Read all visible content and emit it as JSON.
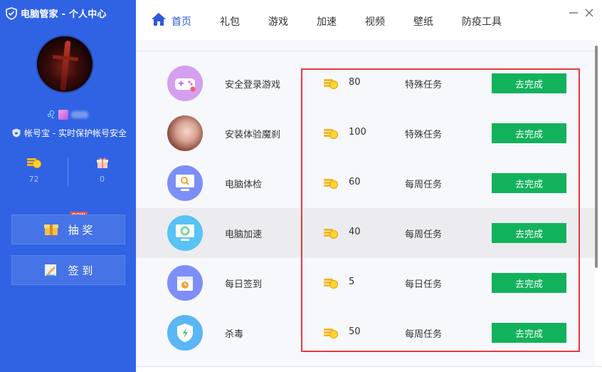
{
  "app": {
    "title": "电脑管家 - 个人中心"
  },
  "sidebar": {
    "guard_text": "帐号宝 - 实时保护帐号安全",
    "coins": "72",
    "gifts": "0",
    "new_badge": "new",
    "lottery_label": "抽 奖",
    "checkin_label": "签 到"
  },
  "nav": {
    "tabs": [
      {
        "label": "首页",
        "active": true
      },
      {
        "label": "礼包"
      },
      {
        "label": "游戏"
      },
      {
        "label": "加速"
      },
      {
        "label": "视频"
      },
      {
        "label": "壁纸"
      },
      {
        "label": "防疫工具"
      }
    ]
  },
  "tasks": [
    {
      "name": "安全登录游戏",
      "points": "80",
      "type": "特殊任务",
      "action": "去完成",
      "icon": "gamepad-icon"
    },
    {
      "name": "安装体验魔刹",
      "points": "100",
      "type": "特殊任务",
      "action": "去完成",
      "icon": "game-character-icon"
    },
    {
      "name": "电脑体检",
      "points": "60",
      "type": "每周任务",
      "action": "去完成",
      "icon": "pc-checkup-icon"
    },
    {
      "name": "电脑加速",
      "points": "40",
      "type": "每周任务",
      "action": "去完成",
      "icon": "pc-speedup-icon"
    },
    {
      "name": "每日签到",
      "points": "5",
      "type": "每日任务",
      "action": "去完成",
      "icon": "calendar-icon"
    },
    {
      "name": "杀毒",
      "points": "50",
      "type": "每周任务",
      "action": "去完成",
      "icon": "antivirus-shield-icon"
    }
  ],
  "colors": {
    "sidebar": "#3063e4",
    "accent": "#2c5ad8",
    "action_button": "#12b25c",
    "highlight_box": "#e53a3f"
  }
}
